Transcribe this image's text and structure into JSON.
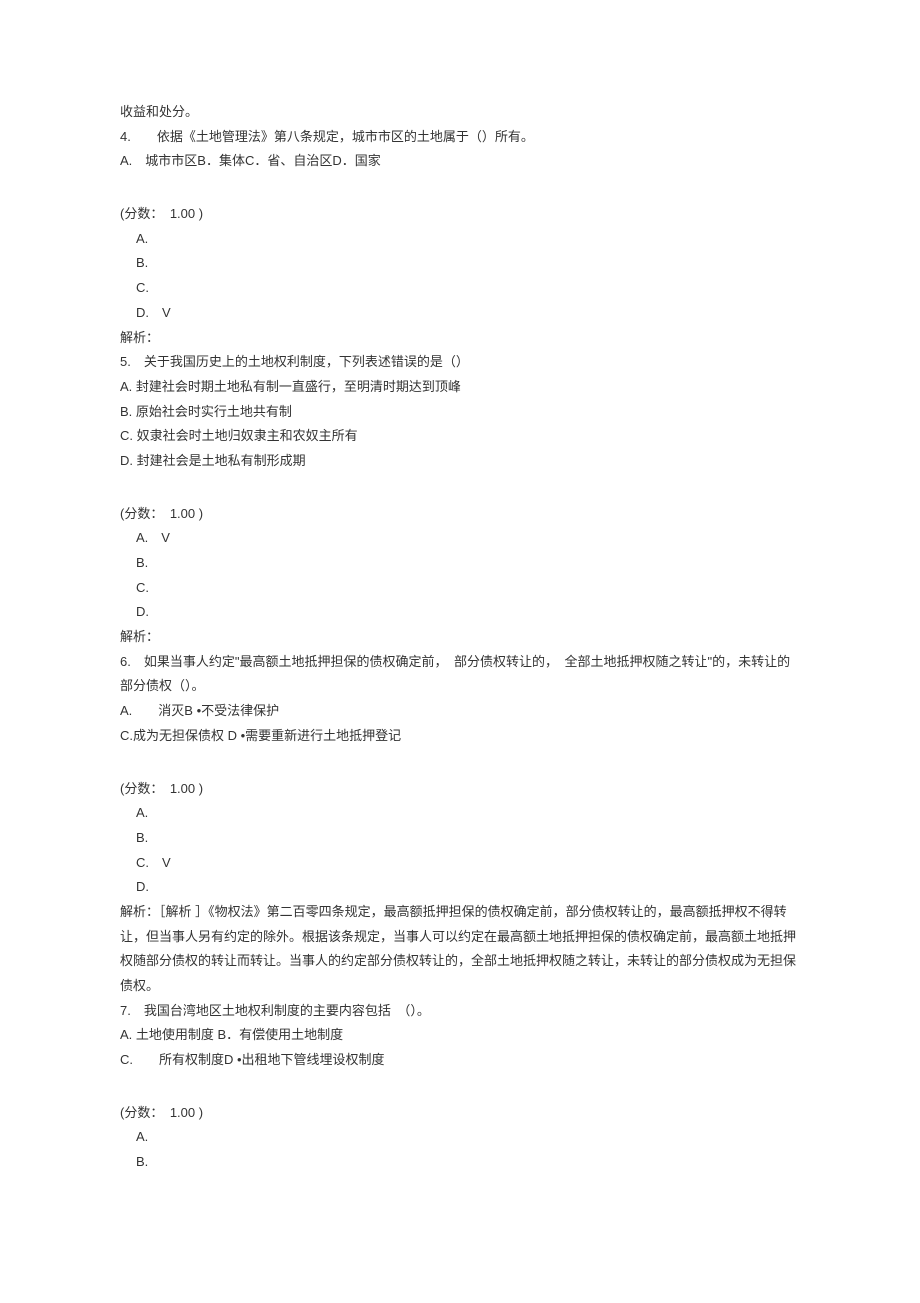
{
  "intro": "收益和处分。",
  "q4": {
    "num": "4.",
    "text": "依据《土地管理法》第八条规定，城市市区的土地属于（）所有。",
    "optionLine": "A.　城市市区B．集体C．省、自治区D．国家",
    "score": "(分数：　1.00 )",
    "a": "A.",
    "b": "B.",
    "c": "C.",
    "d": "D.　V",
    "explain": "解析："
  },
  "q5": {
    "num": "5.",
    "text": "关于我国历史上的土地权利制度，下列表述错误的是（）",
    "optA": "A.  封建社会时期土地私有制一直盛行，至明清时期达到顶峰",
    "optB": "B.  原始社会时实行土地共有制",
    "optC": "C.  奴隶社会时土地归奴隶主和农奴主所有",
    "optD": "D.  封建社会是土地私有制形成期",
    "score": "(分数：　1.00 )",
    "a": "A.　V",
    "b": "B.",
    "c": "C.",
    "d": "D.",
    "explain": "解析："
  },
  "q6": {
    "num": "6.",
    "text": "如果当事人约定\"最高额土地抵押担保的债权确定前，　部分债权转让的，　全部土地抵押权随之转让\"的，未转让的部分债权（）。",
    "opt1": "A.　　消灭B •不受法律保护",
    "opt2": "C.成为无担保债权 D •需要重新进行土地抵押登记",
    "score": "(分数：　1.00 )",
    "a": "A.",
    "b": "B.",
    "c": "C.　V",
    "d": "D.",
    "explain": "解析：［解析 ］《物权法》第二百零四条规定，最高额抵押担保的债权确定前，部分债权转让的，最高额抵押权不得转让，但当事人另有约定的除外。根据该条规定，当事人可以约定在最高额土地抵押担保的债权确定前，最高额土地抵押权随部分债权的转让而转让。当事人的约定部分债权转让的，全部土地抵押权随之转让，未转让的部分债权成为无担保债权。"
  },
  "q7": {
    "num": "7.",
    "text": "我国台湾地区土地权利制度的主要内容包括　（）。",
    "opt1": "A.  土地使用制度 B．有偿使用土地制度",
    "opt2": "C.　　所有权制度D •出租地下管线埋设权制度",
    "score": "(分数：　1.00 )",
    "a": "A.",
    "b": "B."
  }
}
